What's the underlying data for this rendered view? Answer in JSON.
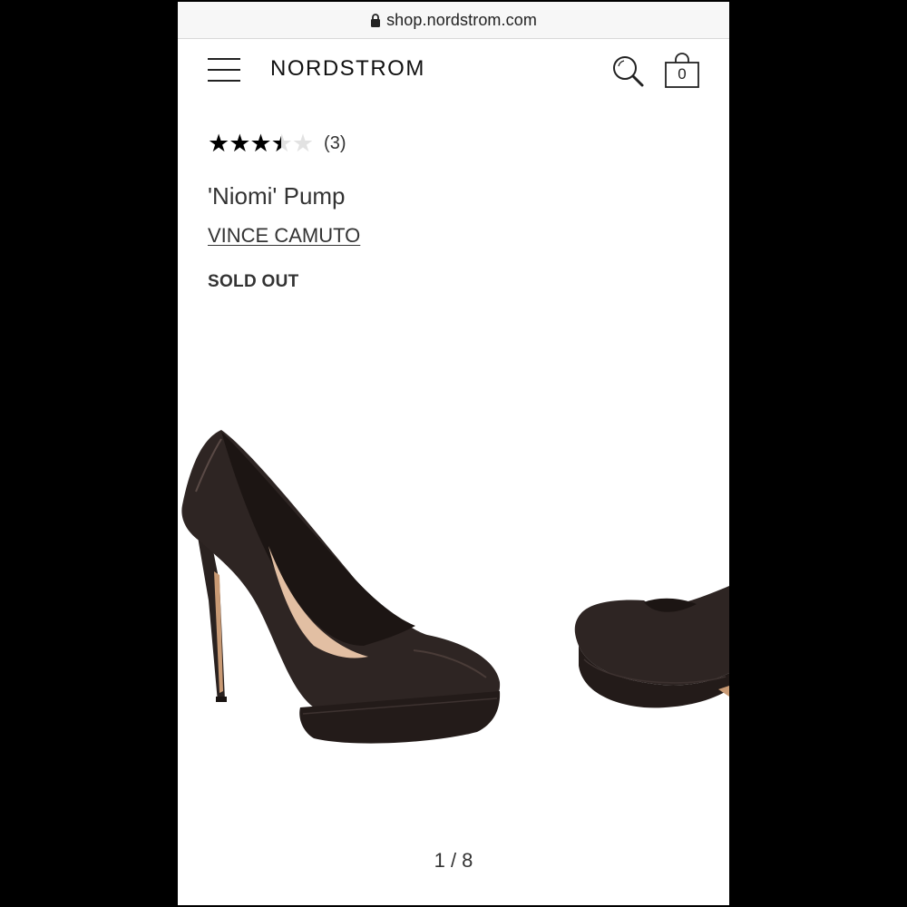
{
  "browser": {
    "url": "shop.nordstrom.com",
    "lock_icon": "lock-icon"
  },
  "header": {
    "menu_icon": "hamburger-menu-icon",
    "logo": "NORDSTROM",
    "search_icon": "search-icon",
    "bag_icon": "shopping-bag-icon",
    "bag_count": "0"
  },
  "product": {
    "rating": 3.5,
    "rating_max": 5,
    "review_count": "(3)",
    "title": "'Niomi' Pump",
    "brand": "VINCE CAMUTO",
    "availability": "SOLD OUT"
  },
  "gallery": {
    "pager": "1 / 8"
  },
  "colors": {
    "shoe_leather": "#2a2220",
    "lining": "#e2bfa3",
    "background": "#ffffff"
  }
}
